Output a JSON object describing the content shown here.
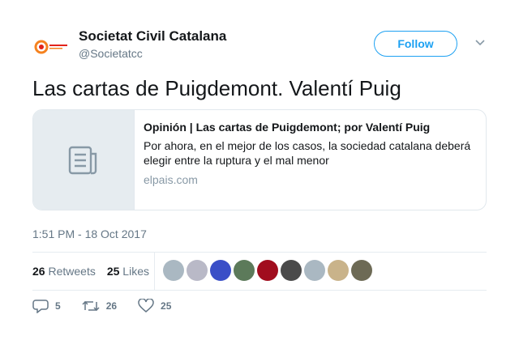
{
  "author": {
    "name": "Societat Civil Catalana",
    "handle": "@Societatcc"
  },
  "follow_label": "Follow",
  "tweet_text": "Las cartas de Puigdemont. Valentí Puig",
  "card": {
    "title": "Opinión | Las cartas de Puigdemont; por Valentí Puig",
    "description": "Por ahora, en el mejor de los casos, la sociedad catalana deberá elegir entre la ruptura y el mal menor",
    "domain": "elpais.com",
    "icon": "document-icon"
  },
  "timestamp": "1:51 PM - 18 Oct 2017",
  "stats": {
    "retweets_count": "26",
    "retweets_label": "Retweets",
    "likes_count": "25",
    "likes_label": "Likes"
  },
  "likers": [
    {
      "color": "#aab8c2"
    },
    {
      "color": "#b9b9c7"
    },
    {
      "color": "#3a4fc7"
    },
    {
      "color": "#5c7a5a"
    },
    {
      "color": "#a10d1e"
    },
    {
      "color": "#4a4a4a"
    },
    {
      "color": "#aab8c2"
    },
    {
      "color": "#c9b38a"
    },
    {
      "color": "#6d6a55"
    }
  ],
  "actions": {
    "reply_count": "5",
    "retweet_count": "26",
    "like_count": "25"
  },
  "colors": {
    "accent": "#1da1f2",
    "muted": "#657786",
    "text": "#14171a",
    "border": "#e1e8ed"
  }
}
